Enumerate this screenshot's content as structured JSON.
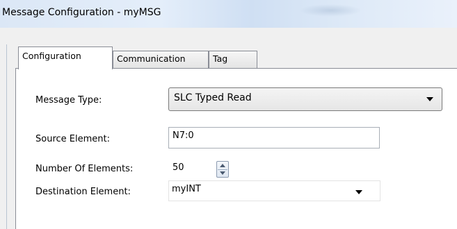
{
  "window": {
    "title": "Message Configuration - myMSG"
  },
  "tabs": [
    {
      "label": "Configuration"
    },
    {
      "label": "Communication"
    },
    {
      "label": "Tag"
    }
  ],
  "form": {
    "message_type": {
      "label": "Message Type:",
      "value": "SLC Typed Read"
    },
    "source_element": {
      "label": "Source Element:",
      "value": "N7:0"
    },
    "number_of_elements": {
      "label": "Number Of Elements:",
      "value": "50"
    },
    "destination_element": {
      "label": "Destination Element:",
      "value": "myINT"
    }
  },
  "icons": {
    "message_type_dropdown": "chevron-down-icon",
    "spinner": "up-down-arrows-icon",
    "destination_dropdown": "chevron-down-icon"
  },
  "colors": {
    "title_bar": "#dbe7f6",
    "panel_background": "#ffffff",
    "dialog_background": "#f0f0f0",
    "border": "#898c95"
  }
}
